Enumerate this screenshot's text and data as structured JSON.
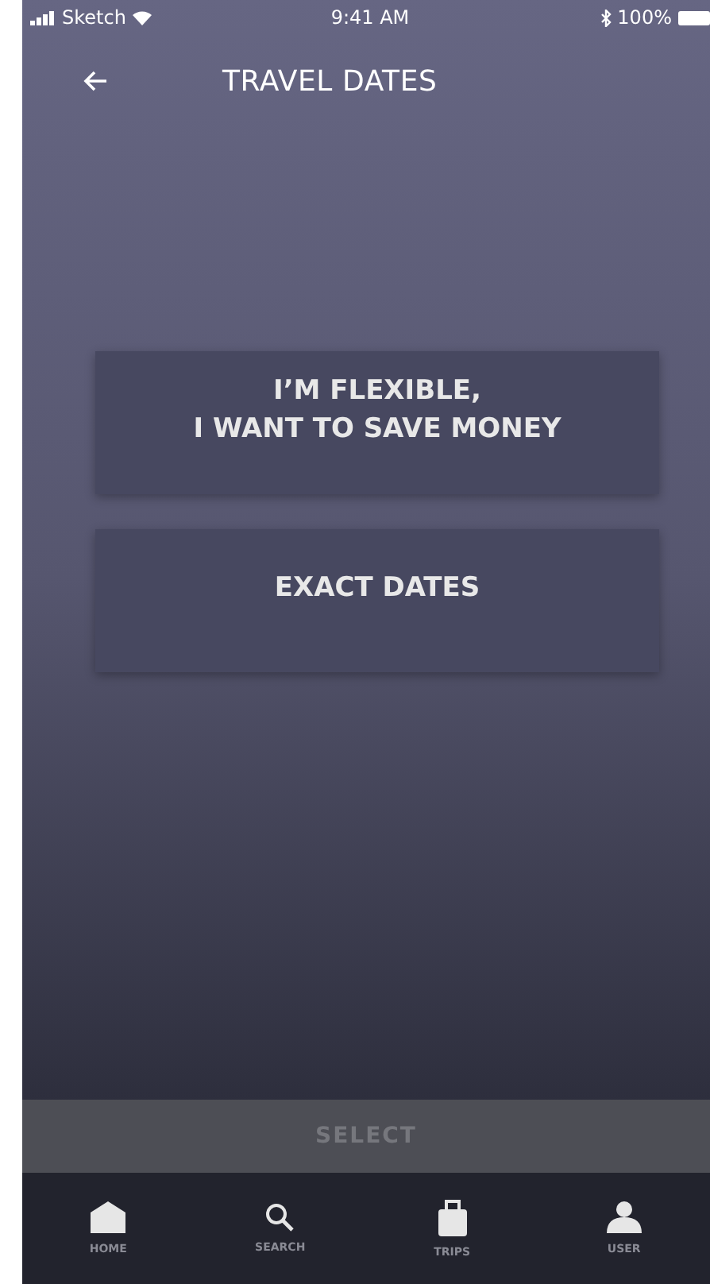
{
  "status_bar": {
    "carrier": "Sketch",
    "time": "9:41 AM",
    "battery": "100%"
  },
  "header": {
    "title": "TRAVEL DATES"
  },
  "options": [
    {
      "label": "I’M FLEXIBLE,\nI WANT TO SAVE MONEY",
      "selected": false
    },
    {
      "label": "EXACT DATES",
      "selected": false
    }
  ],
  "select_button": {
    "label": "SELECT",
    "disabled": true
  },
  "tab_bar": [
    {
      "label": "HOME",
      "kind": "home"
    },
    {
      "label": "SEARCH",
      "kind": "search"
    },
    {
      "label": "TRIPS",
      "kind": "trips"
    },
    {
      "label": "USER",
      "kind": "user"
    }
  ]
}
